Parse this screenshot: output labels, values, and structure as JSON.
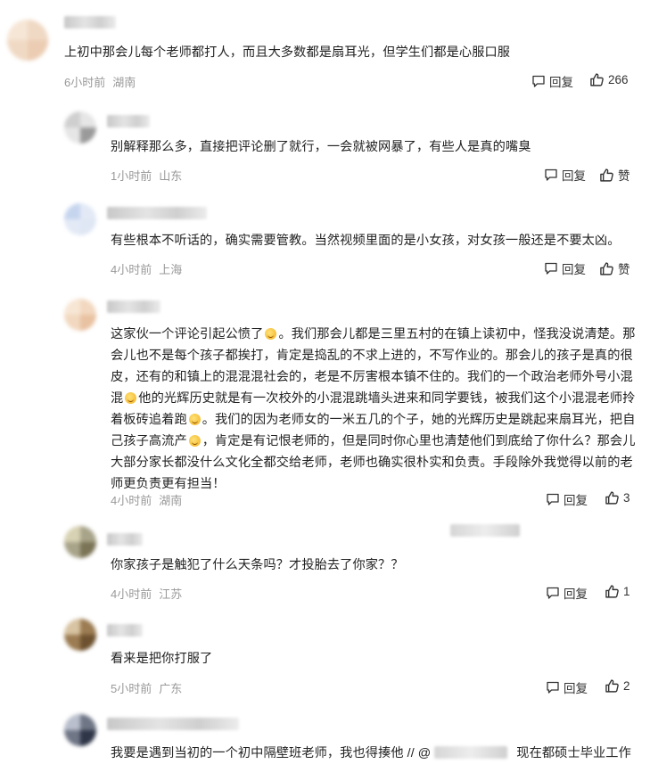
{
  "comments": [
    {
      "text": "上初中那会儿每个老师都打人，而且大多数都是扇耳光，但学生们都是心服口服",
      "time": "6小时前",
      "location": "湖南",
      "reply_label": "回复",
      "like_label": "266"
    },
    {
      "text": "别解释那么多，直接把评论删了就行，一会就被网暴了，有些人是真的嘴臭",
      "time": "1小时前",
      "location": "山东",
      "reply_label": "回复",
      "like_label": "赞"
    },
    {
      "text": "有些根本不听话的，确实需要管教。当然视频里面的是小女孩，对女孩一般还是不要太凶。",
      "time": "4小时前",
      "location": "上海",
      "reply_label": "回复",
      "like_label": "赞"
    },
    {
      "text_parts": [
        "这家伙一个评论引起公愤了",
        "。我们那会儿都是三里五村的在镇上读初中，怪我没说清楚。那会儿也不是每个孩子都挨打，肯定是捣乱的不求上进的，不写作业的。那会儿的孩子是真的很皮，还有的和镇上的混混混社会的，老是不厉害根本镇不住的。我们的一个政治老师外号小混混",
        "他的光辉历史就是有一次校外的小混混跳墙头进来和同学要钱，被我们这个小混混老师拎着板砖追着跑",
        "。我们的因为老师女的一米五几的个子，她的光辉历史是跳起来扇耳光，把自己孩子高流产",
        "，肯定是有记恨老师的，但是同时你心里也清楚他们到底给了你什么？那会儿大部分家长都没什么文化全都交给老师，老师也确实很朴实和负责。手段除外我觉得以前的老师更负责更有担当！"
      ],
      "time": "4小时前",
      "location": "湖南",
      "reply_label": "回复",
      "like_label": "3"
    },
    {
      "text": "你家孩子是触犯了什么天条吗？才投胎去了你家？？",
      "time": "4小时前",
      "location": "江苏",
      "reply_label": "回复",
      "like_label": "1"
    },
    {
      "text": "看来是把你打服了",
      "time": "5小时前",
      "location": "广东",
      "reply_label": "回复",
      "like_label": "2"
    },
    {
      "text_a": "我要是遇到当初的一个初中隔壁班老师，我也得揍他 // @",
      "text_b": "现在都硕士毕业工作"
    }
  ],
  "icons": {
    "reply": "comment-bubble-icon",
    "like": "thumbs-up-icon",
    "emoji": "laughing-emoji-icon"
  },
  "colors": {
    "text": "#222222",
    "meta": "#999999",
    "action": "#333333"
  }
}
